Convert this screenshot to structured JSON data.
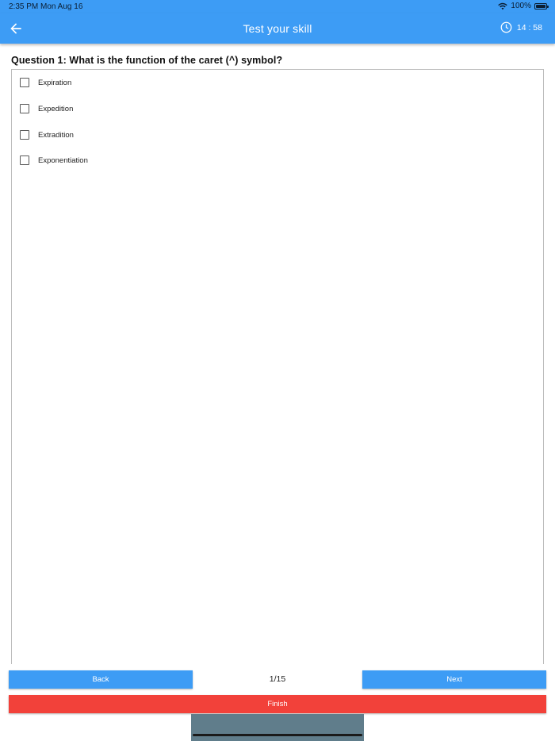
{
  "status_bar": {
    "time": "2:35 PM",
    "date": "Mon Aug 16",
    "battery": "100%"
  },
  "app_bar": {
    "title": "Test your skill",
    "timer": "14 : 58",
    "color": "#3d9cf5"
  },
  "question": {
    "text": "Question 1: What is the function of the caret (^) symbol?",
    "options": [
      {
        "label": "Expiration",
        "checked": false
      },
      {
        "label": "Expedition",
        "checked": false
      },
      {
        "label": "Extradition",
        "checked": false
      },
      {
        "label": "Exponentiation",
        "checked": false
      }
    ]
  },
  "navigation": {
    "back_label": "Back",
    "next_label": "Next",
    "finish_label": "Finish",
    "page_indicator": "1/15",
    "finish_color": "#f2413a"
  },
  "icons": {
    "back": "back-arrow-icon",
    "timer": "clock-icon",
    "wifi": "wifi-icon",
    "battery": "battery-icon"
  }
}
